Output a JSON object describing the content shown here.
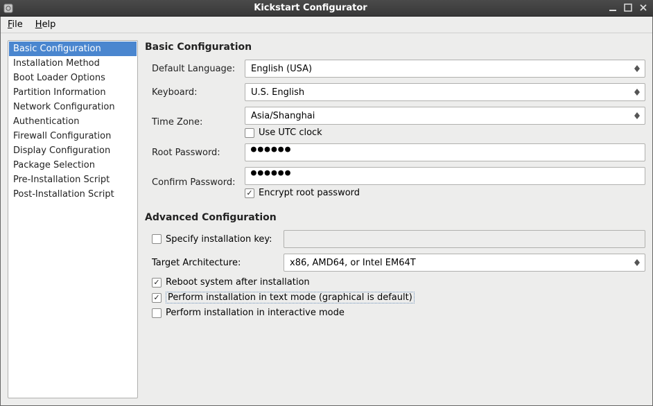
{
  "window": {
    "title": "Kickstart Configurator"
  },
  "menubar": {
    "file": "File",
    "help": "Help"
  },
  "sidebar": {
    "items": [
      "Basic Configuration",
      "Installation Method",
      "Boot Loader Options",
      "Partition Information",
      "Network Configuration",
      "Authentication",
      "Firewall Configuration",
      "Display Configuration",
      "Package Selection",
      "Pre-Installation Script",
      "Post-Installation Script"
    ],
    "selected_index": 0
  },
  "basic": {
    "title": "Basic Configuration",
    "default_language_label": "Default Language:",
    "default_language_value": "English (USA)",
    "keyboard_label": "Keyboard:",
    "keyboard_value": "U.S. English",
    "timezone_label": "Time Zone:",
    "timezone_value": "Asia/Shanghai",
    "utc_label": "Use UTC clock",
    "utc_checked": false,
    "root_password_label": "Root Password:",
    "root_password_value": "●●●●●●",
    "confirm_password_label": "Confirm Password:",
    "confirm_password_value": "●●●●●●",
    "encrypt_label": "Encrypt root password",
    "encrypt_checked": true
  },
  "advanced": {
    "title": "Advanced Configuration",
    "specify_key_label": "Specify installation key:",
    "specify_key_checked": false,
    "specify_key_value": "",
    "target_arch_label": "Target Architecture:",
    "target_arch_value": "x86, AMD64, or Intel EM64T",
    "reboot_label": "Reboot system after installation",
    "reboot_checked": true,
    "text_mode_label": "Perform installation in text mode (graphical is default)",
    "text_mode_checked": true,
    "interactive_label": "Perform installation in interactive mode",
    "interactive_checked": false
  }
}
